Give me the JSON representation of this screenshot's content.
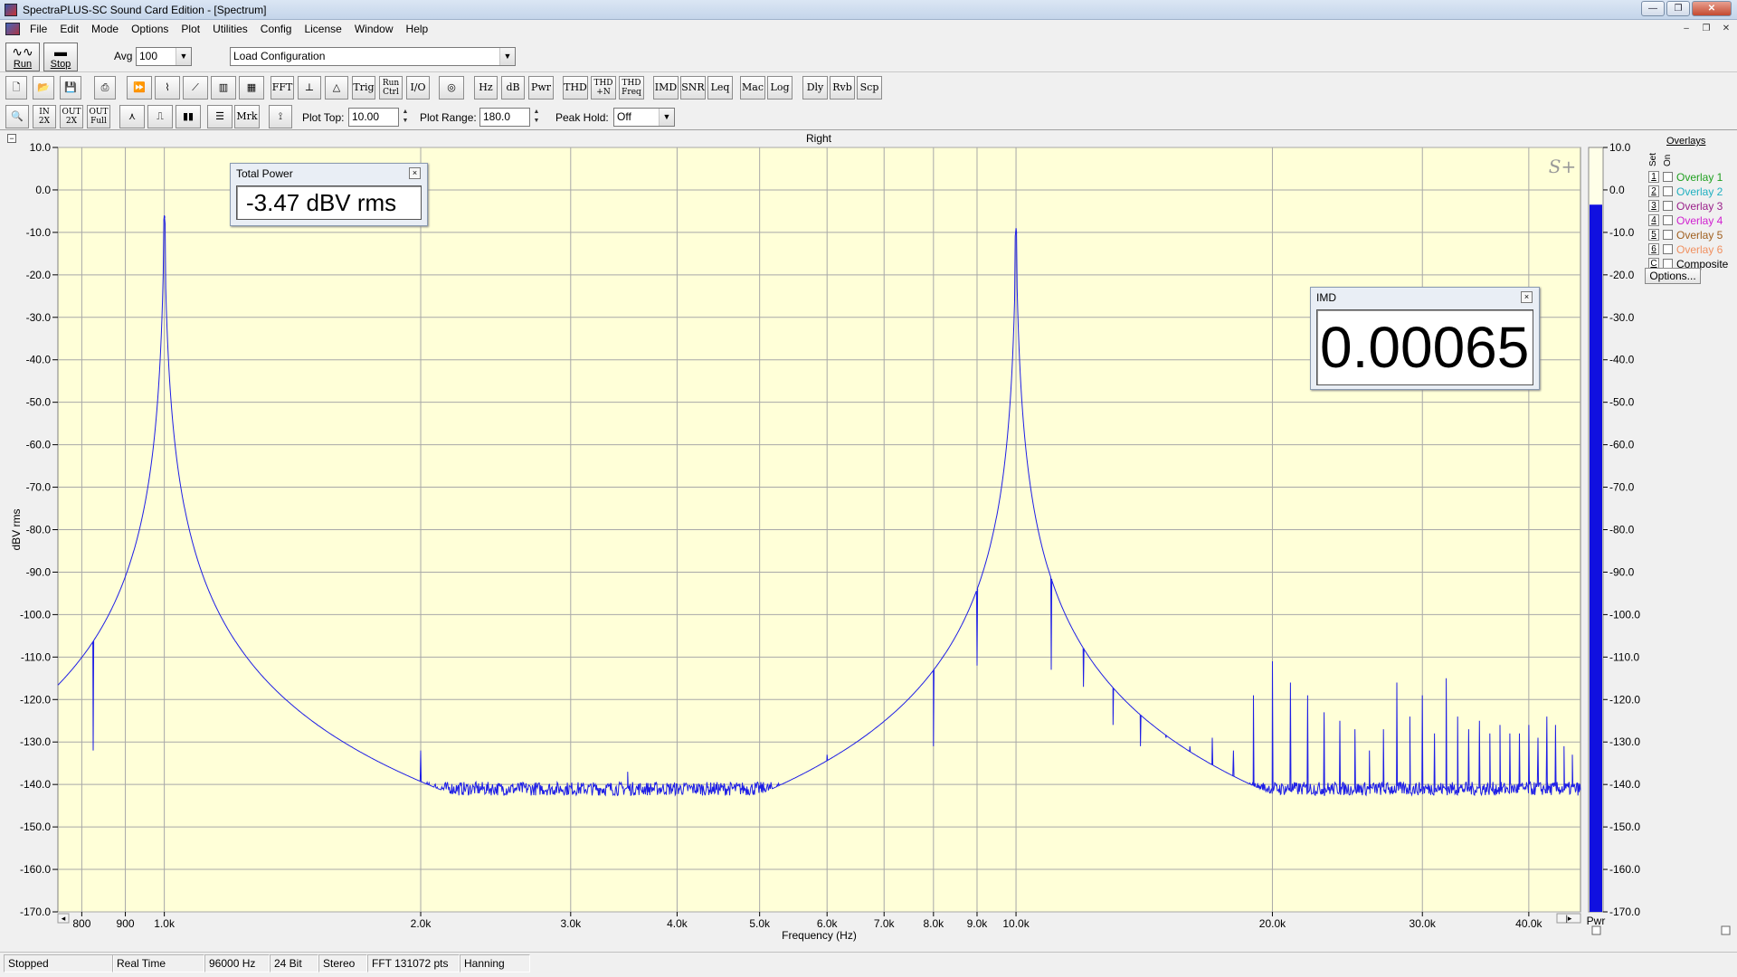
{
  "window": {
    "title": "SpectraPLUS-SC Sound Card Edition - [Spectrum]"
  },
  "menu": [
    "File",
    "Edit",
    "Mode",
    "Options",
    "Plot",
    "Utilities",
    "Config",
    "License",
    "Window",
    "Help"
  ],
  "toolbar1": {
    "run_label": "Run",
    "stop_label": "Stop",
    "avg_label": "Avg",
    "avg_value": "100",
    "config_value": "Load Configuration"
  },
  "toolbar2": {
    "fft": "FFT",
    "trig": "Trig",
    "run_ctrl_top": "Run",
    "run_ctrl_bottom": "Ctrl",
    "io": "I/O",
    "hz": "Hz",
    "db": "dB",
    "pwr": "Pwr",
    "thd": "THD",
    "thdn_top": "THD",
    "thdn_bottom": "+N",
    "thdf_top": "THD",
    "thdf_bottom": "Freq",
    "imd": "IMD",
    "snr": "SNR",
    "leq": "Leq",
    "mac": "Mac",
    "log": "Log",
    "dly": "Dly",
    "rvb": "Rvb",
    "scp": "Scp"
  },
  "toolbar3": {
    "zoom_in_top": "IN",
    "zoom_in_bottom": "2X",
    "zoom_out_top": "OUT",
    "zoom_out_bottom": "2X",
    "zoom_full_top": "OUT",
    "zoom_full_bottom": "Full",
    "mrk": "Mrk",
    "plot_top_label": "Plot Top:",
    "plot_top_value": "10.00",
    "plot_range_label": "Plot Range:",
    "plot_range_value": "180.0",
    "peak_hold_label": "Peak Hold:",
    "peak_hold_value": "Off"
  },
  "chart_data": {
    "type": "line",
    "title": "Right",
    "xlabel": "Frequency (Hz)",
    "ylabel": "dBV rms",
    "x_scale": "log",
    "xlim": [
      750,
      46000
    ],
    "ylim": [
      -170,
      10
    ],
    "y_ticks": [
      10,
      0,
      -10,
      -20,
      -30,
      -40,
      -50,
      -60,
      -70,
      -80,
      -90,
      -100,
      -110,
      -120,
      -130,
      -140,
      -150,
      -160,
      -170
    ],
    "y_tick_labels": [
      "10.0",
      "0.0",
      "-10.0",
      "-20.0",
      "-30.0",
      "-40.0",
      "-50.0",
      "-60.0",
      "-70.0",
      "-80.0",
      "-90.0",
      "-100.0",
      "-110.0",
      "-120.0",
      "-130.0",
      "-140.0",
      "-150.0",
      "-160.0",
      "-170.0"
    ],
    "x_ticks": [
      800,
      900,
      1000,
      2000,
      3000,
      4000,
      5000,
      6000,
      7000,
      8000,
      9000,
      10000,
      20000,
      30000,
      40000
    ],
    "x_tick_labels": [
      "800",
      "900",
      "1.0k",
      "2.0k",
      "3.0k",
      "4.0k",
      "5.0k",
      "6.0k",
      "7.0k",
      "8.0k",
      "9.0k",
      "10.0k",
      "20.0k",
      "30.0k",
      "40.0k"
    ],
    "grid": true,
    "line_color": "#1e1ee6",
    "background": "#ffffd8",
    "noise_floor": -141,
    "peaks": [
      {
        "x": 1000,
        "y": -6
      },
      {
        "x": 10000,
        "y": -9
      }
    ],
    "spurs": [
      {
        "x": 825,
        "y": -132
      },
      {
        "x": 2000,
        "y": -132
      },
      {
        "x": 3500,
        "y": -137
      },
      {
        "x": 6000,
        "y": -133
      },
      {
        "x": 8000,
        "y": -131
      },
      {
        "x": 9000,
        "y": -112
      },
      {
        "x": 11000,
        "y": -113
      },
      {
        "x": 12000,
        "y": -117
      },
      {
        "x": 13000,
        "y": -126
      },
      {
        "x": 14000,
        "y": -131
      },
      {
        "x": 15000,
        "y": -129
      },
      {
        "x": 16000,
        "y": -131
      },
      {
        "x": 17000,
        "y": -129
      },
      {
        "x": 18000,
        "y": -132
      },
      {
        "x": 19000,
        "y": -119
      },
      {
        "x": 20000,
        "y": -111
      },
      {
        "x": 21000,
        "y": -116
      },
      {
        "x": 22000,
        "y": -119
      },
      {
        "x": 23000,
        "y": -123
      },
      {
        "x": 24000,
        "y": -125
      },
      {
        "x": 25000,
        "y": -127
      },
      {
        "x": 26000,
        "y": -132
      },
      {
        "x": 27000,
        "y": -127
      },
      {
        "x": 28000,
        "y": -116
      },
      {
        "x": 29000,
        "y": -124
      },
      {
        "x": 30000,
        "y": -119
      },
      {
        "x": 31000,
        "y": -128
      },
      {
        "x": 32000,
        "y": -115
      },
      {
        "x": 33000,
        "y": -124
      },
      {
        "x": 34000,
        "y": -127
      },
      {
        "x": 35000,
        "y": -125
      },
      {
        "x": 36000,
        "y": -128
      },
      {
        "x": 37000,
        "y": -126
      },
      {
        "x": 38000,
        "y": -128
      },
      {
        "x": 39000,
        "y": -128
      },
      {
        "x": 40000,
        "y": -126
      },
      {
        "x": 41000,
        "y": -129
      },
      {
        "x": 42000,
        "y": -124
      },
      {
        "x": 43000,
        "y": -126
      },
      {
        "x": 44000,
        "y": -131
      },
      {
        "x": 45000,
        "y": -133
      }
    ]
  },
  "level_meter": {
    "label": "Pwr",
    "value_dbv": -3.47,
    "tick_labels": [
      "10.0",
      "0.0",
      "-10.0",
      "-20.0",
      "-30.0",
      "-40.0",
      "-50.0",
      "-60.0",
      "-70.0",
      "-80.0",
      "-90.0",
      "-100.0",
      "-110.0",
      "-120.0",
      "-130.0",
      "-140.0",
      "-150.0",
      "-160.0",
      "-170.0"
    ],
    "color": "#1010e0"
  },
  "total_power": {
    "title": "Total Power",
    "value": "-3.47 dBV rms"
  },
  "imd": {
    "title": "IMD",
    "value": "0.00065"
  },
  "overlays": {
    "heading": "Overlays",
    "set_label": "Set",
    "on_label": "On",
    "items": [
      {
        "num": "1",
        "name": "Overlay 1",
        "color": "#20a020"
      },
      {
        "num": "2",
        "name": "Overlay 2",
        "color": "#20b0c0"
      },
      {
        "num": "3",
        "name": "Overlay 3",
        "color": "#9a208a"
      },
      {
        "num": "4",
        "name": "Overlay 4",
        "color": "#d020d0"
      },
      {
        "num": "5",
        "name": "Overlay 5",
        "color": "#a06020"
      },
      {
        "num": "6",
        "name": "Overlay 6",
        "color": "#f09060"
      },
      {
        "num": "C",
        "name": "Composite",
        "color": "#000000"
      }
    ],
    "options_label": "Options..."
  },
  "branding": "S+",
  "status": [
    "Stopped",
    "Real Time",
    "96000 Hz",
    "24 Bit",
    "Stereo",
    "FFT 131072 pts",
    "Hanning"
  ]
}
